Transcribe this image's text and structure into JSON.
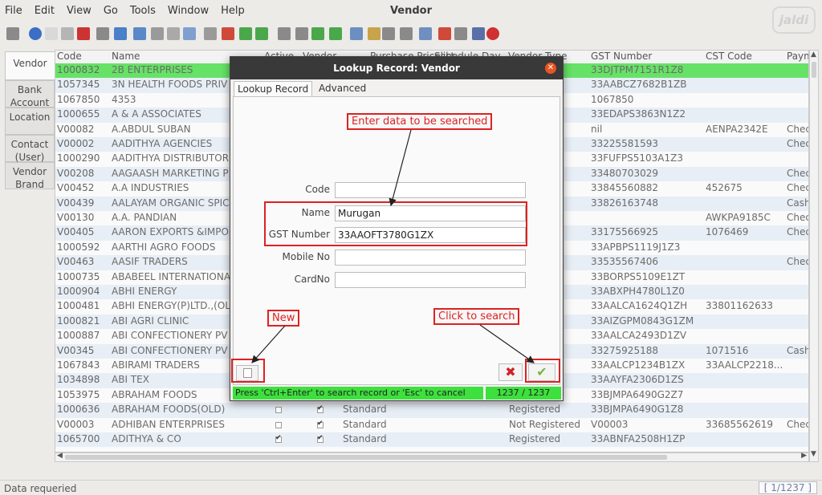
{
  "menu": [
    "File",
    "Edit",
    "View",
    "Go",
    "Tools",
    "Window",
    "Help"
  ],
  "app_title": "Vendor",
  "watermark": "jaldi",
  "left_tabs": [
    {
      "label": "Vendor",
      "active": true
    },
    {
      "label": "Bank Account"
    },
    {
      "label": "Location"
    },
    {
      "label": "Contact (User)"
    },
    {
      "label": "Vendor Brand"
    }
  ],
  "grid": {
    "columns": [
      "Code",
      "Name",
      "Active",
      "Vendor",
      "Purchase Pricelist",
      "Schedule Day",
      "Vendor Type",
      "GST Number",
      "CST Code",
      "Paym"
    ],
    "rows": [
      {
        "code": "1000832",
        "name": "2B ENTERPRISES",
        "gst": "33DJTPM7151R1Z8",
        "cst": "",
        "pay": "",
        "selected": true
      },
      {
        "code": "1057345",
        "name": "3N HEALTH FOODS PRIV",
        "gst": "33AABCZ7682B1ZB",
        "cst": "",
        "pay": ""
      },
      {
        "code": "1067850",
        "name": "4353",
        "gst": "1067850",
        "cst": "",
        "pay": ""
      },
      {
        "code": "1000655",
        "name": "A & A ASSOCIATES",
        "gst": "33EDAPS3863N1Z2",
        "cst": "",
        "pay": ""
      },
      {
        "code": "V00082",
        "name": "A.ABDUL SUBAN",
        "gst": "nil",
        "cst": "AENPA2342E",
        "pay": "Chec"
      },
      {
        "code": "V00002",
        "name": "AADITHYA AGENCIES",
        "gst": "33225581593",
        "cst": "",
        "pay": "Chec"
      },
      {
        "code": "1000290",
        "name": "AADITHYA DISTRIBUTOR",
        "gst": "33FUFPS5103A1Z3",
        "cst": "",
        "pay": ""
      },
      {
        "code": "V00208",
        "name": "AAGAASH MARKETING P",
        "gst": "33480703029",
        "cst": "",
        "pay": "Chec"
      },
      {
        "code": "V00452",
        "name": "A.A INDUSTRIES",
        "gst": "33845560882",
        "cst": "452675",
        "pay": "Chec"
      },
      {
        "code": "V00439",
        "name": "AALAYAM ORGANIC SPIC",
        "gst": "33826163748",
        "cst": "",
        "pay": "Cash"
      },
      {
        "code": "V00130",
        "name": "A.A. PANDIAN",
        "vtype": "ered",
        "gst": "",
        "cst": "AWKPA9185C",
        "pay": "Chec"
      },
      {
        "code": "V00405",
        "name": "AARON EXPORTS &IMPO",
        "gst": "33175566925",
        "cst": "1076469",
        "pay": "Chec"
      },
      {
        "code": "1000592",
        "name": "AARTHI AGRO FOODS",
        "gst": "33APBPS1119J1Z3",
        "cst": "",
        "pay": ""
      },
      {
        "code": "V00463",
        "name": "AASIF TRADERS",
        "gst": "33535567406",
        "cst": "",
        "pay": "Chec"
      },
      {
        "code": "1000735",
        "name": "ABABEEL INTERNATIONA",
        "gst": "33BORPS5109E1ZT",
        "cst": "",
        "pay": ""
      },
      {
        "code": "1000904",
        "name": "ABHI ENERGY",
        "gst": "33ABXPH4780L1Z0",
        "cst": "",
        "pay": ""
      },
      {
        "code": "1000481",
        "name": "ABHI ENERGY(P)LTD.,(OL",
        "gst": "33AALCA1624Q1ZH",
        "cst": "33801162633",
        "pay": ""
      },
      {
        "code": "1000821",
        "name": "ABI AGRI CLINIC",
        "gst": "33AIZGPM0843G1ZM",
        "cst": "",
        "pay": ""
      },
      {
        "code": "1000887",
        "name": "ABI CONFECTIONERY PV",
        "gst": "33AALCA2493D1ZV",
        "cst": "",
        "pay": ""
      },
      {
        "code": "V00345",
        "name": "ABI CONFECTIONERY PV",
        "gst": "33275925188",
        "cst": "1071516",
        "pay": "Cash"
      },
      {
        "code": "1067843",
        "name": "ABIRAMI TRADERS",
        "gst": "33AALCP1234B1ZX",
        "cst": "33AALCP2218...",
        "pay": ""
      },
      {
        "code": "1034898",
        "name": "ABI TEX",
        "gst": "33AAYFA2306D1ZS",
        "cst": "",
        "pay": ""
      },
      {
        "code": "1053975",
        "name": "ABRAHAM FOODS",
        "gst": "33BJMPA6490G2Z7",
        "cst": "",
        "pay": ""
      },
      {
        "code": "1000636",
        "name": "ABRAHAM FOODS(OLD)",
        "active": false,
        "vendor": true,
        "pricelist": "Standard",
        "vtype": "Registered",
        "gst": "33BJMPA6490G1Z8",
        "cst": "",
        "pay": ""
      },
      {
        "code": "V00003",
        "name": "ADHIBAN ENTERPRISES",
        "active": false,
        "vendor": true,
        "pricelist": "Standard",
        "vtype": "Not Registered",
        "gst": "V00003",
        "cst": "33685562619",
        "pay": "Chec"
      },
      {
        "code": "1065700",
        "name": "ADITHYA & CO",
        "active": true,
        "vendor": true,
        "pricelist": "Standard",
        "vtype": "Registered",
        "gst": "33ABNFA2508H1ZP",
        "cst": "",
        "pay": ""
      }
    ]
  },
  "status": {
    "message": "Data requeried",
    "counter": "[ 1/1237 ]"
  },
  "dialog": {
    "title": "Lookup Record: Vendor",
    "tabs": [
      "Lookup Record",
      "Advanced"
    ],
    "fields": [
      {
        "label": "Code",
        "value": ""
      },
      {
        "label": "Name",
        "value": "Murugan"
      },
      {
        "label": "GST Number",
        "value": "33AAOFT3780G1ZX"
      },
      {
        "label": "Mobile No",
        "value": ""
      },
      {
        "label": "CardNo",
        "value": ""
      }
    ],
    "hint": "Press 'Ctrl+Enter' to search record or 'Esc' to cancel",
    "count": "1237 / 1237"
  },
  "annotations": {
    "enter_data": "Enter data to be searched",
    "new": "New",
    "click_search": "Click to search"
  },
  "colors": {
    "selected_row": "#66e266",
    "alt_row": "#e8eef6",
    "annotation": "#dd2222",
    "dialog_titlebar": "#393939",
    "close_button": "#e95420",
    "hint_bar": "#3ee03e"
  },
  "icons": [
    "undo-icon",
    "help-icon",
    "new-icon",
    "copy-icon",
    "delete-icon",
    "save-icon",
    "refresh-icon",
    "find-icon",
    "attachment-icon",
    "chat-icon",
    "zoom-icon",
    "history-icon",
    "home-icon",
    "back-icon",
    "forward-icon",
    "first-icon",
    "previous-icon",
    "next-icon",
    "last-icon",
    "report-icon",
    "archive-icon",
    "print-icon",
    "print-preview-icon",
    "zoom-across-icon",
    "workflow-icon",
    "lock-icon",
    "request-icon",
    "close-window-icon"
  ]
}
